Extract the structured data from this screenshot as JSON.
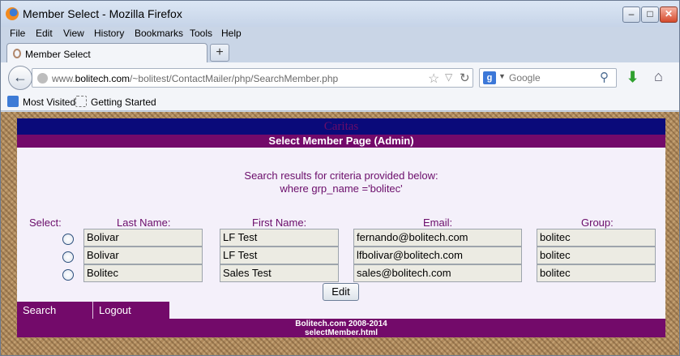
{
  "window": {
    "title": "Member Select - Mozilla Firefox",
    "min_label": "–",
    "max_label": "□",
    "close_label": "✕"
  },
  "menu": [
    "File",
    "Edit",
    "View",
    "History",
    "Bookmarks",
    "Tools",
    "Help"
  ],
  "tab": {
    "label": "Member Select",
    "new_tab_label": "+"
  },
  "nav": {
    "url_prefix": "www.",
    "url_domain": "bolitech.com",
    "url_path": "/~bolitest/ContactMailer/php/SearchMember.php",
    "search_engine_icon": "google-icon",
    "search_placeholder": "Google"
  },
  "bookmarks": [
    "Most Visited",
    "Getting Started"
  ],
  "page": {
    "site_name": "Caritas",
    "page_title": "Select Member Page (Admin)",
    "criteria_line1": "Search results for criteria provided below:",
    "criteria_line2": "where grp_name ='bolitec'",
    "headers": {
      "select": "Select:",
      "last_name": "Last Name:",
      "first_name": "First Name:",
      "email": "Email:",
      "group": "Group:"
    },
    "rows": [
      {
        "last_name": "Bolivar",
        "first_name": "LF Test",
        "email": "fernando@bolitech.com",
        "group": "bolitec"
      },
      {
        "last_name": "Bolivar",
        "first_name": "LF Test",
        "email": "lfbolivar@bolitech.com",
        "group": "bolitec"
      },
      {
        "last_name": "Bolitec",
        "first_name": "Sales Test",
        "email": "sales@bolitech.com",
        "group": "bolitec"
      }
    ],
    "edit_button": "Edit",
    "nav_search": "Search",
    "nav_logout": "Logout",
    "footer_line1": "Bolitech.com 2008-2014",
    "footer_line2": "selectMember.html"
  },
  "colors": {
    "banner_blue": "#0a0a7a",
    "accent_purple": "#730a6a",
    "label_purple": "#6a0c6a"
  }
}
